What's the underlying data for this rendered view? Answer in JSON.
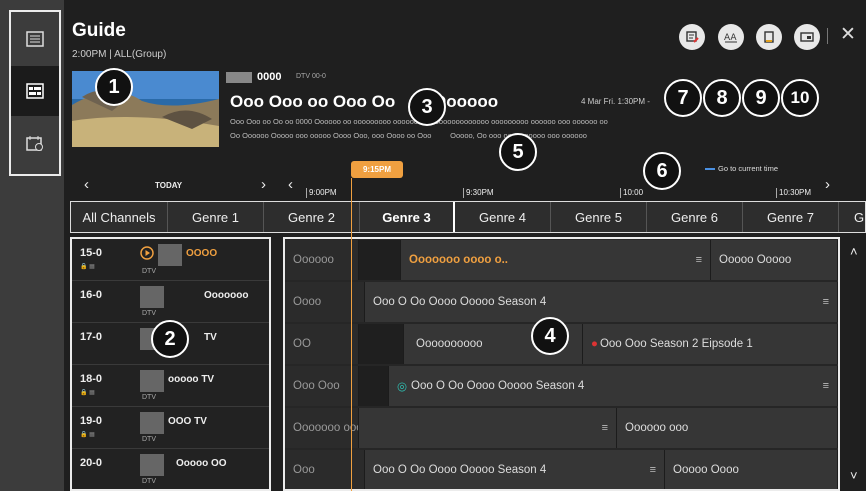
{
  "app": {
    "title": "Guide",
    "subtitle": "2:00PM | ALL(Group)",
    "close_glyph": "✕"
  },
  "colors": {
    "accent": "#f0a040",
    "goto_marker": "#4a90e2",
    "callout_bg": "#111111",
    "outline": "#ececec"
  },
  "rail": {
    "items": [
      {
        "icon": "list-icon",
        "selected": false
      },
      {
        "icon": "grid-guide-icon",
        "selected": true
      },
      {
        "icon": "schedule-icon",
        "selected": false
      }
    ]
  },
  "toolbar_icons": [
    "record-icon",
    "text-size-icon",
    "reminder-icon",
    "picture-in-picture-icon"
  ],
  "current_program": {
    "channel_number": "0000",
    "channel_type": "DTV 00-0",
    "title": "Ooo Ooo oo Ooo Oo        Oooooo",
    "datetime": "4 Mar Fri. 1:30PM -",
    "description_lines": [
      "Ooo Ooo oo Oo oo 0000 Oooooo oo ooooooooo ooooooo oo ooooooooooooo ooooooooo oooooo ooo oooooo oo",
      "Oo Oooooo Ooooo ooo ooooo Oooo Ooo, ooo Oooo oo Ooo         Ooooo, Oo ooo oooooooooo ooo oooooo"
    ]
  },
  "timeline": {
    "day_prev_glyph": "‹",
    "day_label": "TODAY",
    "day_next_glyph": "›",
    "time_prev_glyph": "‹",
    "time_next_glyph": "›",
    "now": "9:15PM",
    "goto_label": "Go to current time",
    "ticks": [
      "9:00PM",
      "9:30PM",
      "10:00",
      "10:30PM"
    ]
  },
  "genres": [
    "All Channels",
    "Genre 1",
    "Genre 2",
    "Genre 3",
    "Genre 4",
    "Genre 5",
    "Genre 6",
    "Genre 7",
    "G"
  ],
  "genres_selected": 3,
  "channels": [
    {
      "num": "15-0",
      "name": "OOOO",
      "type": "DTV",
      "live": true
    },
    {
      "num": "16-0",
      "name": "Ooooooo",
      "type": "DTV",
      "live": false
    },
    {
      "num": "17-0",
      "name": "TV",
      "type": "",
      "live": false
    },
    {
      "num": "18-0",
      "name": "ooooo TV",
      "type": "DTV",
      "live": false
    },
    {
      "num": "19-0",
      "name": "OOO TV",
      "type": "DTV",
      "live": false
    },
    {
      "num": "20-0",
      "name": "Ooooo OO",
      "type": "DTV",
      "live": false
    }
  ],
  "programs": [
    [
      {
        "title": "Oooooo",
        "kind": "past"
      },
      {
        "title": "",
        "kind": "dark"
      },
      {
        "title": "Ooooooo oooo o..",
        "kind": "live",
        "menu": true
      },
      {
        "title": "Ooooo Ooooo",
        "kind": "normal"
      }
    ],
    [
      {
        "title": "Oooo",
        "kind": "past"
      },
      {
        "title": "Ooo O Oo Oooo Ooooo Season 4",
        "kind": "normal",
        "menu": true
      }
    ],
    [
      {
        "title": "OO",
        "kind": "past"
      },
      {
        "title": "",
        "kind": "dark"
      },
      {
        "title": "Oooooooooo",
        "kind": "normal"
      },
      {
        "title": "Ooo Ooo Season 2 Eipsode 1",
        "kind": "normal"
      }
    ],
    [
      {
        "title": "Ooo Ooo",
        "kind": "past"
      },
      {
        "title": "",
        "kind": "dark"
      },
      {
        "title": "Ooo O Oo Oooo Ooooo Season 4",
        "kind": "normal",
        "menu": true
      }
    ],
    [
      {
        "title": "Ooooooo ooo",
        "kind": "past"
      },
      {
        "title": "",
        "kind": "normal",
        "menu": true
      },
      {
        "title": "Oooooo ooo",
        "kind": "normal"
      }
    ],
    [
      {
        "title": "Ooo",
        "kind": "past"
      },
      {
        "title": "Ooo O Oo Oooo Ooooo Season 4",
        "kind": "normal",
        "menu": true
      },
      {
        "title": "Ooooo Oooo",
        "kind": "normal"
      }
    ]
  ],
  "grid_nav": {
    "up_glyph": "˄",
    "down_glyph": "˅"
  },
  "callouts": [
    "1",
    "2",
    "3",
    "4",
    "5",
    "6",
    "7",
    "8",
    "9",
    "10"
  ]
}
